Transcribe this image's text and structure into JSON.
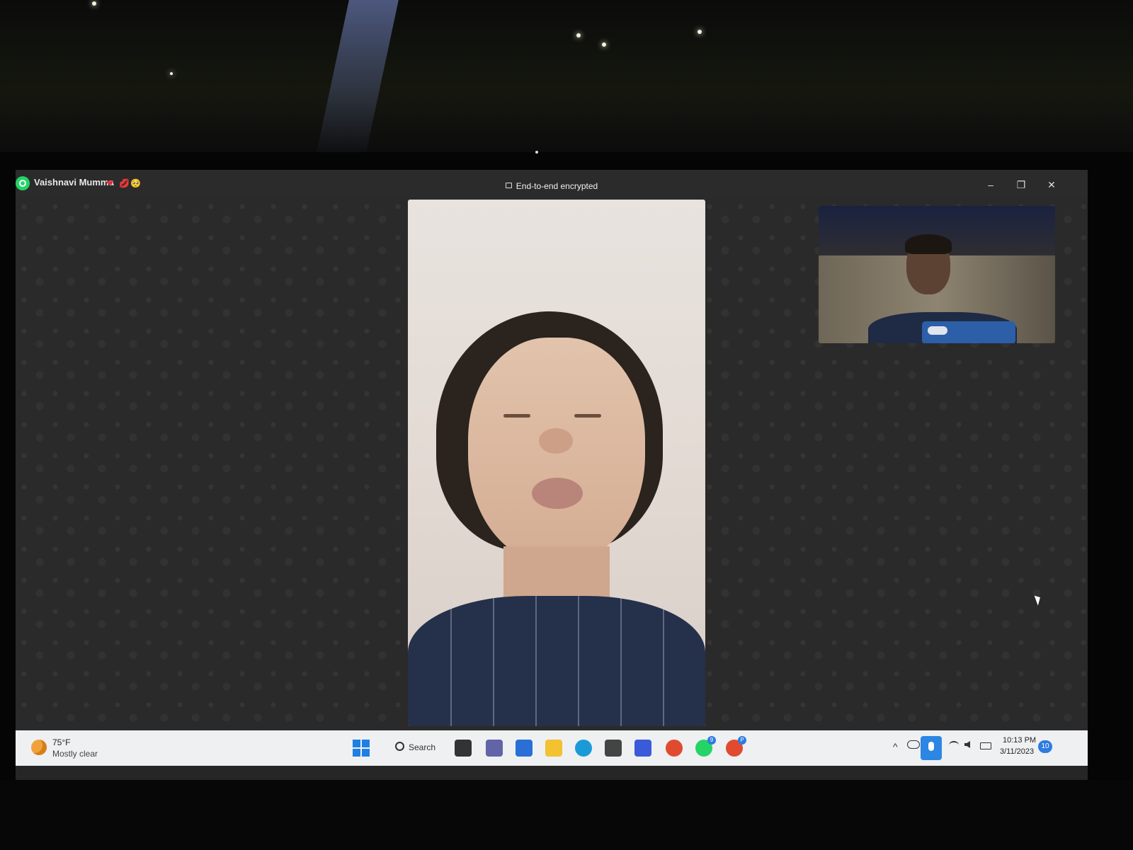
{
  "window": {
    "contact_name": "Vaishnavi Mumma",
    "contact_emojis": [
      "❤",
      "💋",
      "🥺"
    ],
    "encryption_label": "End-to-end encrypted",
    "minimize_glyph": "–",
    "restore_glyph": "❐",
    "close_glyph": "✕"
  },
  "call": {
    "main_video": "remote-participant",
    "self_preview": "local-camera"
  },
  "taskbar": {
    "weather": {
      "temperature": "75°F",
      "condition": "Mostly clear",
      "icon": "moon-cloud-icon"
    },
    "search_label": "Search",
    "pinned_apps": [
      {
        "name": "file-explorer-icon",
        "color": "#333333"
      },
      {
        "name": "teams-chat-icon",
        "color": "#6264a7"
      },
      {
        "name": "microsoft-store-icon",
        "color": "#2a6fd6"
      },
      {
        "name": "folder-icon",
        "color": "#f2c230"
      },
      {
        "name": "edge-icon",
        "color": "#1a9bd7"
      },
      {
        "name": "app-hexagon-icon",
        "color": "#444444"
      },
      {
        "name": "app-blue-icon",
        "color": "#3a5bd9"
      },
      {
        "name": "chrome-icon",
        "color": "#e04a2f"
      },
      {
        "name": "whatsapp-icon",
        "color": "#25d366",
        "badge": "9"
      },
      {
        "name": "chrome-profile-icon",
        "color": "#e04a2f",
        "badge": "P"
      }
    ],
    "tray": {
      "chevron": "^",
      "clock_time": "10:13 PM",
      "clock_date": "3/11/2023",
      "notification_count": "10"
    }
  }
}
